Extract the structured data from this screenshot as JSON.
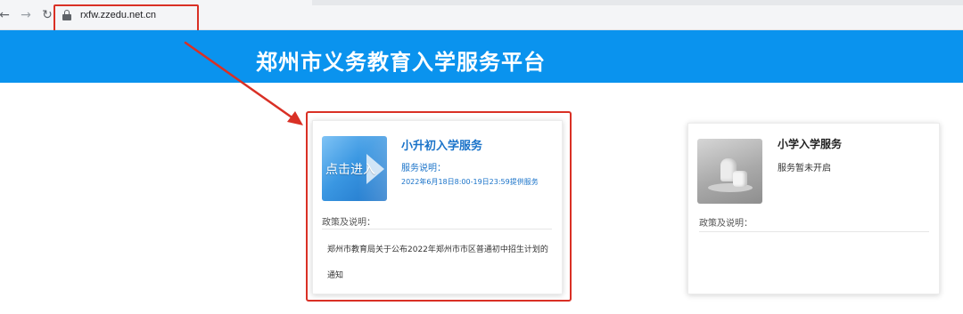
{
  "browser": {
    "url": "rxfw.zzedu.net.cn",
    "back_glyph": "←",
    "forward_glyph": "→",
    "reload_glyph": "↻"
  },
  "header": {
    "title": "郑州市义务教育入学服务平台"
  },
  "cards": {
    "junior": {
      "title": "小升初入学服务",
      "thumb_label": "点击进入",
      "service_label": "服务说明：",
      "service_time": "2022年6月18日8:00-19日23:59提供服务",
      "policy_label": "政策及说明：",
      "notice": "郑州市教育局关于公布2022年郑州市市区普通初中招生计划的通知"
    },
    "primary": {
      "title": "小学入学服务",
      "service_status": "服务暂未开启",
      "policy_label": "政策及说明："
    }
  },
  "colors": {
    "banner": "#0a93ee",
    "annotation": "#d93025",
    "link_blue": "#1a73c9"
  }
}
